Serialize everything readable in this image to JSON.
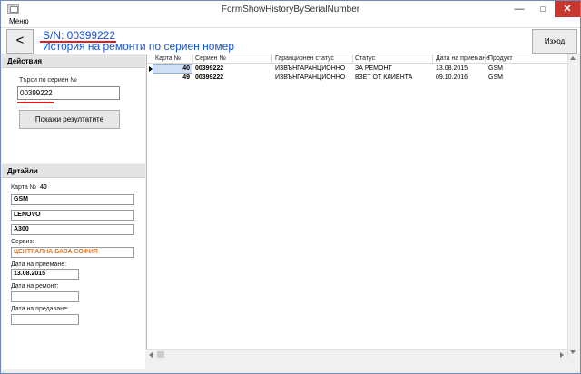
{
  "window": {
    "title": "FormShowHistoryBySerialNumber"
  },
  "menu": {
    "item": "Меню"
  },
  "header": {
    "back_label": "<",
    "serial_title": "S/N: 00399222",
    "subtitle": "История на ремонти по сериен номер",
    "exit_label": "Изход"
  },
  "actions": {
    "title": "Действия",
    "search_label": "Търси по сериен №",
    "search_value": "00399222",
    "show_button": "Покажи резултатите"
  },
  "details": {
    "title": "Дртайли",
    "card_label": "Карта №",
    "card_value": "40",
    "field1": "GSM",
    "field2": "LENOVO",
    "field3": "A300",
    "service_label": "Сервиз:",
    "service_value": "ЦЕНТРАЛНА БАЗА СОФИЯ",
    "service_color": "#e07a2a",
    "date_received_label": "Дата на приемане:",
    "date_received_value": "13.08.2015",
    "date_repair_label": "Дата на ремонт:",
    "date_repair_value": "",
    "date_delivery_label": "Дата на предаване:",
    "date_delivery_value": ""
  },
  "grid": {
    "columns": [
      "Карта №",
      "Сериен №",
      "Гаранционен статус",
      "Статус",
      "Дата на приемане",
      "Продукт"
    ],
    "rows": [
      {
        "card": "40",
        "serial": "00399222",
        "warranty": "ИЗВЪНГАРАНЦИОННО",
        "status": "ЗА РЕМОНТ",
        "date": "13.08.2015",
        "product": "GSM"
      },
      {
        "card": "49",
        "serial": "00399222",
        "warranty": "ИЗВЪНГАРАНЦИОННО",
        "status": "ВЗЕТ ОТ КЛИЕНТА",
        "date": "09.10.2016",
        "product": "GSM"
      }
    ]
  },
  "icons": {
    "minimize": "minimize-icon",
    "maximize": "maximize-icon",
    "close": "close-icon",
    "row_selector": "row-selector-icon"
  }
}
